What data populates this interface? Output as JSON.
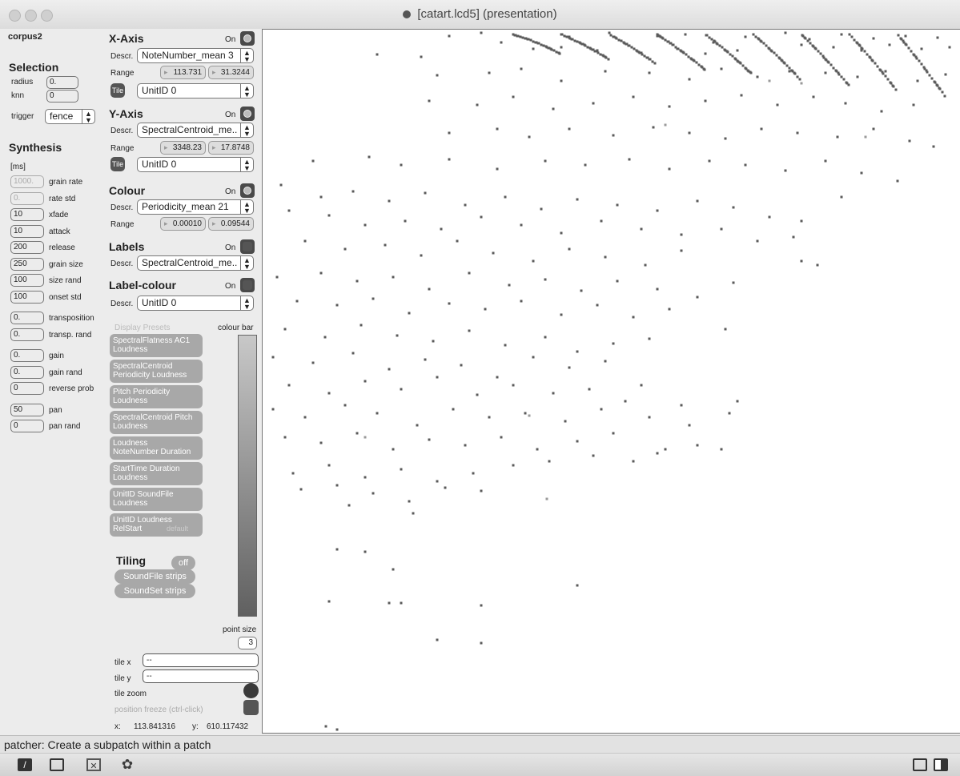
{
  "window": {
    "title": "[catart.lcd5] (presentation)"
  },
  "corpus": "corpus2",
  "selection": {
    "heading": "Selection",
    "radius_label": "radius",
    "radius_value": "0.",
    "knn_label": "knn",
    "knn_value": "0",
    "trigger_label": "trigger",
    "trigger_value": "fence"
  },
  "synthesis": {
    "heading": "Synthesis",
    "unit": "[ms]",
    "params": [
      {
        "value": "1000.",
        "label": "grain rate",
        "grey": true
      },
      {
        "value": "0.",
        "label": "rate std",
        "grey": true
      },
      {
        "value": "10",
        "label": "xfade"
      },
      {
        "value": "10",
        "label": "attack"
      },
      {
        "value": "200",
        "label": "release"
      },
      {
        "value": "250",
        "label": "grain size"
      },
      {
        "value": "100",
        "label": "size rand"
      },
      {
        "value": "100",
        "label": "onset std"
      },
      {
        "value": "0.",
        "label": "transposition"
      },
      {
        "value": "0.",
        "label": "transp. rand"
      },
      {
        "value": "0.",
        "label": "gain"
      },
      {
        "value": "0.",
        "label": "gain rand"
      },
      {
        "value": "0",
        "label": "reverse prob"
      },
      {
        "value": "50",
        "label": "pan"
      },
      {
        "value": "0",
        "label": "pan rand"
      }
    ]
  },
  "xaxis": {
    "heading": "X-Axis",
    "on": "On",
    "descr_label": "Descr.",
    "descr": "NoteNumber_mean 3",
    "range_label": "Range",
    "range_min": "113.731",
    "range_max": "31.3244",
    "tile": "Tile",
    "tile_menu": "UnitID 0"
  },
  "yaxis": {
    "heading": "Y-Axis",
    "on": "On",
    "descr_label": "Descr.",
    "descr": "SpectralCentroid_me..",
    "range_label": "Range",
    "range_min": "3348.23",
    "range_max": "17.8748",
    "tile": "Tile",
    "tile_menu": "UnitID 0"
  },
  "colour": {
    "heading": "Colour",
    "on": "On",
    "descr_label": "Descr.",
    "descr": "Periodicity_mean 21",
    "range_label": "Range",
    "range_min": "0.00010",
    "range_max": "0.09544"
  },
  "labels": {
    "heading": "Labels",
    "on": "On",
    "descr_label": "Descr.",
    "descr": "SpectralCentroid_me.."
  },
  "label_colour": {
    "heading": "Label-colour",
    "on": "On",
    "descr_label": "Descr.",
    "descr": "UnitID 0"
  },
  "presets": {
    "heading": "Display Presets",
    "colour_bar": "colour bar",
    "items": [
      {
        "line1": "SpectralFlatness AC1",
        "line2": "Loudness"
      },
      {
        "line1": "SpectralCentroid",
        "line2": "Periodicity Loudness"
      },
      {
        "line1": "Pitch Periodicity",
        "line2": "Loudness"
      },
      {
        "line1": "SpectralCentroid Pitch",
        "line2": "Loudness"
      },
      {
        "line1": "Loudness",
        "line2": "NoteNumber Duration"
      },
      {
        "line1": "StartTime Duration",
        "line2": "Loudness"
      },
      {
        "line1": "UnitID SoundFile",
        "line2": "Loudness"
      },
      {
        "line1": "UnitID Loudness",
        "line2": "RelStart"
      }
    ],
    "default_label": "default"
  },
  "tiling": {
    "heading": "Tiling",
    "off": "off",
    "soundfile": "SoundFile strips",
    "soundset": "SoundSet strips"
  },
  "point_size": {
    "label": "point size",
    "value": "3"
  },
  "tile_x": {
    "label": "tile x",
    "value": "--"
  },
  "tile_y": {
    "label": "tile y",
    "value": "--"
  },
  "tile_zoom": "tile zoom",
  "position_freeze": "position freeze (ctrl-click)",
  "coords": {
    "x_label": "x:",
    "x_value": "113.841316",
    "y_label": "y:",
    "y_value": "610.117432"
  },
  "status": "patcher: Create a subpatch within a patch",
  "colors": {
    "point": "#5a5a5a",
    "point_light": "#9a9a9a",
    "background": "#ececec"
  },
  "toolbar_icons": [
    "edit-icon",
    "presentation-icon",
    "patcher-icon",
    "settings-icon"
  ],
  "scatter_points": [
    [
      560,
      44
    ],
    [
      600,
      40
    ],
    [
      625,
      52
    ],
    [
      710,
      45
    ],
    [
      760,
      40
    ],
    [
      820,
      44
    ],
    [
      855,
      42
    ],
    [
      890,
      52
    ],
    [
      930,
      45
    ],
    [
      980,
      40
    ],
    [
      1010,
      48
    ],
    [
      1050,
      42
    ],
    [
      1090,
      47
    ],
    [
      1130,
      44
    ],
    [
      1170,
      46
    ],
    [
      470,
      67
    ],
    [
      525,
      70
    ],
    [
      665,
      60
    ],
    [
      700,
      58
    ],
    [
      745,
      62
    ],
    [
      800,
      65
    ],
    [
      845,
      60
    ],
    [
      880,
      66
    ],
    [
      920,
      62
    ],
    [
      960,
      60
    ],
    [
      1000,
      55
    ],
    [
      1040,
      58
    ],
    [
      1075,
      62
    ],
    [
      1110,
      55
    ],
    [
      1150,
      60
    ],
    [
      1185,
      58
    ],
    [
      545,
      93
    ],
    [
      610,
      90
    ],
    [
      650,
      85
    ],
    [
      700,
      100
    ],
    [
      755,
      88
    ],
    [
      810,
      90
    ],
    [
      860,
      98
    ],
    [
      900,
      85
    ],
    [
      945,
      95
    ],
    [
      985,
      88
    ],
    [
      1030,
      90
    ],
    [
      1070,
      95
    ],
    [
      1105,
      88
    ],
    [
      1145,
      100
    ],
    [
      1180,
      92
    ],
    [
      535,
      125
    ],
    [
      595,
      130
    ],
    [
      640,
      120
    ],
    [
      690,
      135
    ],
    [
      740,
      128
    ],
    [
      790,
      120
    ],
    [
      835,
      132
    ],
    [
      880,
      125
    ],
    [
      925,
      118
    ],
    [
      970,
      130
    ],
    [
      1015,
      120
    ],
    [
      1055,
      128
    ],
    [
      1100,
      138
    ],
    [
      1140,
      130
    ],
    [
      560,
      165
    ],
    [
      620,
      160
    ],
    [
      660,
      170
    ],
    [
      710,
      160
    ],
    [
      765,
      168
    ],
    [
      815,
      158
    ],
    [
      860,
      165
    ],
    [
      905,
      172
    ],
    [
      950,
      160
    ],
    [
      995,
      165
    ],
    [
      1045,
      170
    ],
    [
      1090,
      160
    ],
    [
      1135,
      175
    ],
    [
      1165,
      182
    ],
    [
      390,
      200
    ],
    [
      460,
      195
    ],
    [
      500,
      205
    ],
    [
      560,
      198
    ],
    [
      620,
      210
    ],
    [
      680,
      200
    ],
    [
      730,
      205
    ],
    [
      785,
      198
    ],
    [
      835,
      210
    ],
    [
      885,
      200
    ],
    [
      930,
      205
    ],
    [
      980,
      212
    ],
    [
      1030,
      200
    ],
    [
      1075,
      215
    ],
    [
      1120,
      225
    ],
    [
      350,
      230
    ],
    [
      400,
      245
    ],
    [
      440,
      238
    ],
    [
      485,
      250
    ],
    [
      530,
      240
    ],
    [
      580,
      255
    ],
    [
      630,
      245
    ],
    [
      675,
      260
    ],
    [
      720,
      248
    ],
    [
      770,
      255
    ],
    [
      820,
      262
    ],
    [
      870,
      250
    ],
    [
      915,
      258
    ],
    [
      960,
      270
    ],
    [
      1000,
      275
    ],
    [
      1050,
      245
    ],
    [
      360,
      262
    ],
    [
      410,
      268
    ],
    [
      455,
      280
    ],
    [
      505,
      275
    ],
    [
      550,
      285
    ],
    [
      600,
      270
    ],
    [
      650,
      280
    ],
    [
      700,
      290
    ],
    [
      750,
      275
    ],
    [
      800,
      285
    ],
    [
      850,
      292
    ],
    [
      900,
      285
    ],
    [
      945,
      300
    ],
    [
      990,
      295
    ],
    [
      380,
      300
    ],
    [
      430,
      310
    ],
    [
      480,
      305
    ],
    [
      525,
      318
    ],
    [
      570,
      300
    ],
    [
      615,
      315
    ],
    [
      665,
      325
    ],
    [
      710,
      310
    ],
    [
      755,
      320
    ],
    [
      805,
      330
    ],
    [
      850,
      312
    ],
    [
      1000,
      325
    ],
    [
      1020,
      330
    ],
    [
      345,
      345
    ],
    [
      400,
      340
    ],
    [
      445,
      350
    ],
    [
      490,
      345
    ],
    [
      535,
      360
    ],
    [
      585,
      340
    ],
    [
      635,
      355
    ],
    [
      680,
      348
    ],
    [
      725,
      362
    ],
    [
      770,
      350
    ],
    [
      820,
      360
    ],
    [
      870,
      370
    ],
    [
      915,
      352
    ],
    [
      370,
      375
    ],
    [
      420,
      380
    ],
    [
      465,
      372
    ],
    [
      510,
      390
    ],
    [
      560,
      378
    ],
    [
      605,
      385
    ],
    [
      650,
      375
    ],
    [
      700,
      392
    ],
    [
      745,
      380
    ],
    [
      790,
      395
    ],
    [
      835,
      385
    ],
    [
      905,
      410
    ],
    [
      355,
      410
    ],
    [
      405,
      420
    ],
    [
      450,
      405
    ],
    [
      495,
      418
    ],
    [
      540,
      425
    ],
    [
      585,
      412
    ],
    [
      630,
      430
    ],
    [
      680,
      420
    ],
    [
      720,
      438
    ],
    [
      765,
      428
    ],
    [
      810,
      422
    ],
    [
      340,
      445
    ],
    [
      390,
      452
    ],
    [
      440,
      440
    ],
    [
      485,
      460
    ],
    [
      530,
      448
    ],
    [
      575,
      455
    ],
    [
      620,
      470
    ],
    [
      665,
      445
    ],
    [
      710,
      458
    ],
    [
      755,
      450
    ],
    [
      800,
      480
    ],
    [
      360,
      480
    ],
    [
      410,
      490
    ],
    [
      455,
      475
    ],
    [
      500,
      485
    ],
    [
      545,
      470
    ],
    [
      595,
      492
    ],
    [
      640,
      480
    ],
    [
      690,
      490
    ],
    [
      735,
      485
    ],
    [
      780,
      500
    ],
    [
      850,
      505
    ],
    [
      910,
      515
    ],
    [
      340,
      510
    ],
    [
      380,
      520
    ],
    [
      430,
      505
    ],
    [
      470,
      515
    ],
    [
      520,
      530
    ],
    [
      565,
      510
    ],
    [
      610,
      520
    ],
    [
      655,
      515
    ],
    [
      705,
      525
    ],
    [
      750,
      510
    ],
    [
      810,
      520
    ],
    [
      860,
      530
    ],
    [
      920,
      500
    ],
    [
      355,
      545
    ],
    [
      400,
      552
    ],
    [
      445,
      540
    ],
    [
      490,
      560
    ],
    [
      535,
      548
    ],
    [
      580,
      555
    ],
    [
      625,
      545
    ],
    [
      670,
      560
    ],
    [
      720,
      550
    ],
    [
      765,
      540
    ],
    [
      820,
      565
    ],
    [
      870,
      555
    ],
    [
      900,
      560
    ],
    [
      365,
      590
    ],
    [
      410,
      580
    ],
    [
      455,
      595
    ],
    [
      500,
      585
    ],
    [
      545,
      600
    ],
    [
      590,
      590
    ],
    [
      640,
      580
    ],
    [
      685,
      575
    ],
    [
      740,
      568
    ],
    [
      790,
      575
    ],
    [
      830,
      560
    ],
    [
      375,
      610
    ],
    [
      420,
      605
    ],
    [
      465,
      615
    ],
    [
      510,
      625
    ],
    [
      555,
      608
    ],
    [
      600,
      612
    ],
    [
      435,
      630
    ],
    [
      515,
      640
    ],
    [
      420,
      685
    ],
    [
      455,
      688
    ],
    [
      490,
      710
    ],
    [
      410,
      750
    ],
    [
      485,
      752
    ],
    [
      500,
      752
    ],
    [
      600,
      755
    ],
    [
      720,
      730
    ],
    [
      545,
      798
    ],
    [
      600,
      802
    ],
    [
      406,
      906
    ],
    [
      420,
      910
    ]
  ],
  "scatter_light": [
    [
      1000,
      103
    ],
    [
      1080,
      170
    ],
    [
      830,
      155
    ],
    [
      960,
      100
    ],
    [
      455,
      545
    ],
    [
      660,
      518
    ],
    [
      682,
      622
    ]
  ]
}
